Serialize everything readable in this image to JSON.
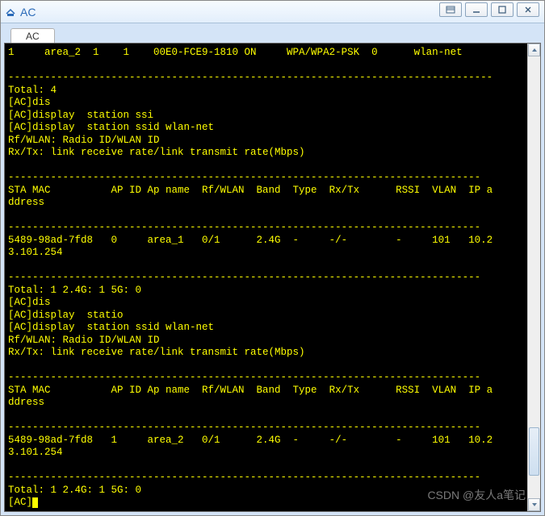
{
  "window": {
    "title": "AC",
    "icon_name": "router-icon"
  },
  "tabs": [
    {
      "label": "AC",
      "active": true
    }
  ],
  "terminal": {
    "lines": [
      "1     area_2  1    1    00E0-FCE9-1810 ON     WPA/WPA2-PSK  0      wlan-net",
      "                                                                           ",
      "--------------------------------------------------------------------------------",
      "Total: 4",
      "[AC]dis",
      "[AC]display  station ssi",
      "[AC]display  station ssid wlan-net",
      "Rf/WLAN: Radio ID/WLAN ID",
      "Rx/Tx: link receive rate/link transmit rate(Mbps)",
      "                                                                           ",
      "------------------------------------------------------------------------------",
      "STA MAC          AP ID Ap name  Rf/WLAN  Band  Type  Rx/Tx      RSSI  VLAN  IP a",
      "ddress",
      "                                                                           ",
      "------------------------------------------------------------------------------",
      "5489-98ad-7fd8   0     area_1   0/1      2.4G  -     -/-        -     101   10.2",
      "3.101.254",
      "                                                                           ",
      "------------------------------------------------------------------------------",
      "Total: 1 2.4G: 1 5G: 0",
      "[AC]dis",
      "[AC]display  statio",
      "[AC]display  station ssid wlan-net",
      "Rf/WLAN: Radio ID/WLAN ID",
      "Rx/Tx: link receive rate/link transmit rate(Mbps)",
      "                                                                           ",
      "------------------------------------------------------------------------------",
      "STA MAC          AP ID Ap name  Rf/WLAN  Band  Type  Rx/Tx      RSSI  VLAN  IP a",
      "ddress",
      "                                                                           ",
      "------------------------------------------------------------------------------",
      "5489-98ad-7fd8   1     area_2   0/1      2.4G  -     -/-        -     101   10.2",
      "3.101.254",
      "                                                                           ",
      "------------------------------------------------------------------------------",
      "Total: 1 2.4G: 1 5G: 0"
    ],
    "prompt": "[AC]"
  },
  "watermark": "CSDN @友人a笔记"
}
